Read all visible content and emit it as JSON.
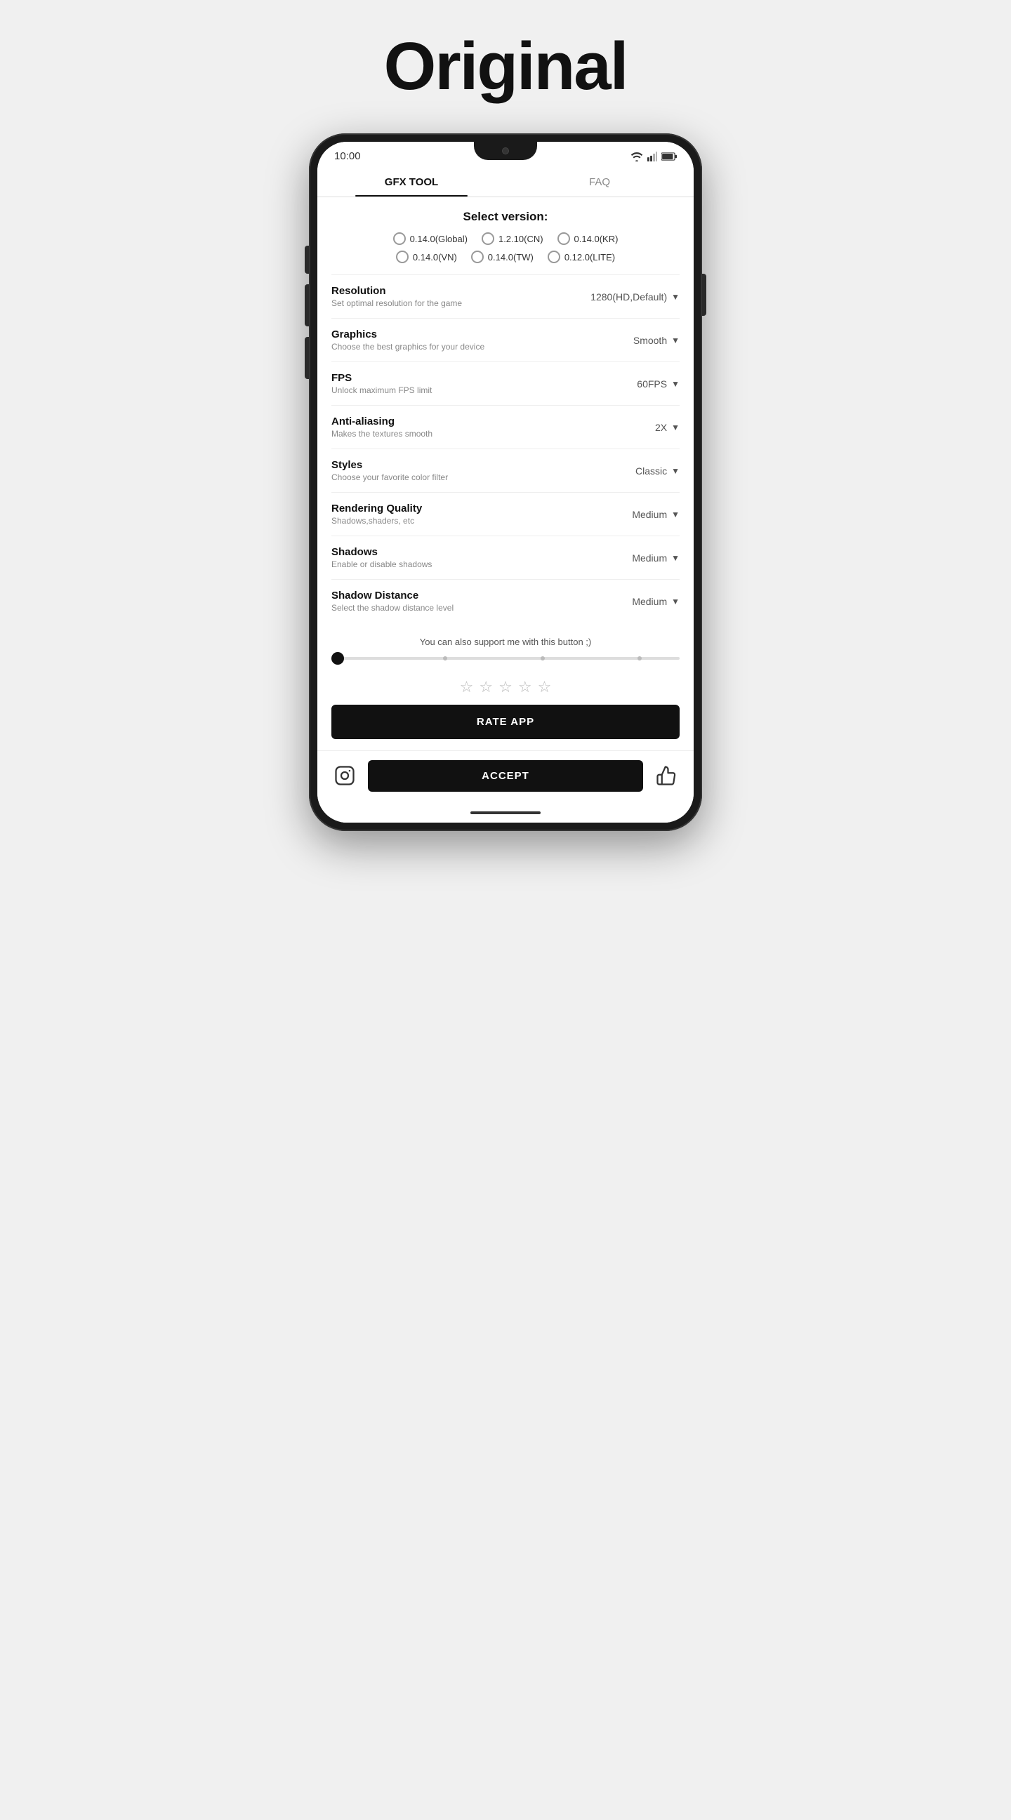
{
  "page": {
    "title": "Original"
  },
  "statusBar": {
    "time": "10:00"
  },
  "tabs": [
    {
      "label": "GFX TOOL",
      "active": true
    },
    {
      "label": "FAQ",
      "active": false
    }
  ],
  "versionSection": {
    "title": "Select version:",
    "options": [
      "0.14.0(Global)",
      "1.2.10(CN)",
      "0.14.0(KR)",
      "0.14.0(VN)",
      "0.14.0(TW)",
      "0.12.0(LITE)"
    ]
  },
  "settings": [
    {
      "label": "Resolution",
      "desc": "Set optimal resolution for the game",
      "value": "1280(HD,Default)"
    },
    {
      "label": "Graphics",
      "desc": "Choose the best graphics for your device",
      "value": "Smooth"
    },
    {
      "label": "FPS",
      "desc": "Unlock maximum FPS limit",
      "value": "60FPS"
    },
    {
      "label": "Anti-aliasing",
      "desc": "Makes the textures smooth",
      "value": "2X"
    },
    {
      "label": "Styles",
      "desc": "Choose your favorite color filter",
      "value": "Classic"
    },
    {
      "label": "Rendering Quality",
      "desc": "Shadows,shaders, etc",
      "value": "Medium"
    },
    {
      "label": "Shadows",
      "desc": "Enable or disable shadows",
      "value": "Medium"
    },
    {
      "label": "Shadow Distance",
      "desc": "Select the shadow distance level",
      "value": "Medium"
    }
  ],
  "support": {
    "text": "You can also support me with this button ;)"
  },
  "rateSection": {
    "stars": [
      "☆",
      "☆",
      "☆",
      "☆",
      "☆"
    ],
    "button": "RATE APP"
  },
  "bottomBar": {
    "accept": "ACCEPT"
  }
}
